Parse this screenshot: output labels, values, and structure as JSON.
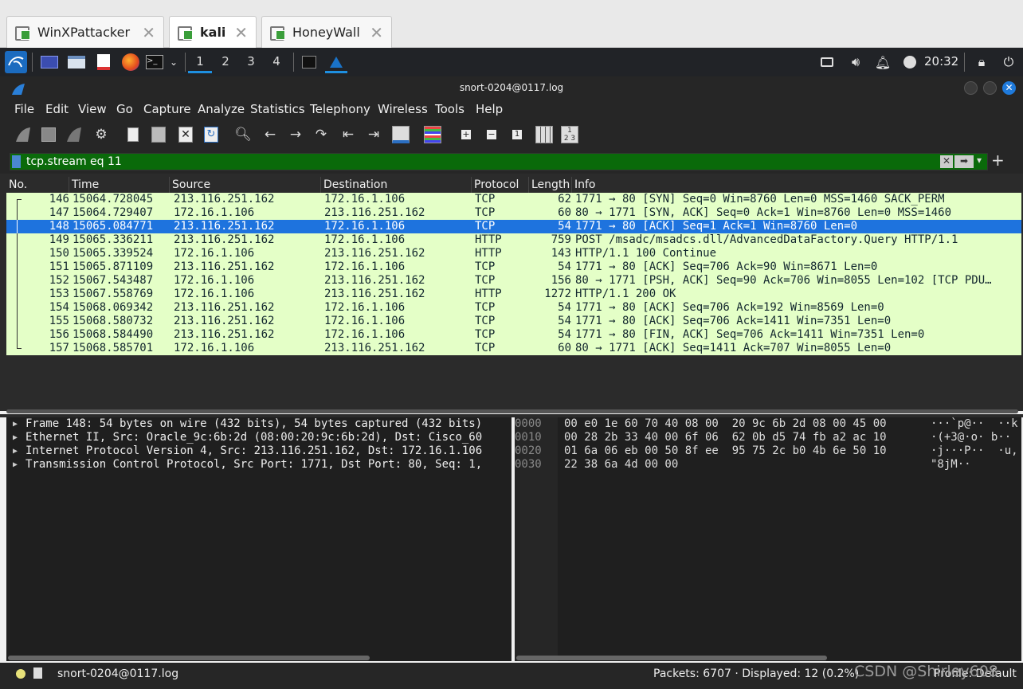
{
  "vm_tabs": [
    {
      "label": "WinXPattacker",
      "active": false
    },
    {
      "label": "kali",
      "active": true
    },
    {
      "label": "HoneyWall",
      "active": false
    }
  ],
  "panel": {
    "workspaces": [
      "1",
      "2",
      "3",
      "4"
    ],
    "active_workspace": "1",
    "clock": "20:32"
  },
  "window": {
    "title": "snort-0204@0117.log"
  },
  "menu": [
    "File",
    "Edit",
    "View",
    "Go",
    "Capture",
    "Analyze",
    "Statistics",
    "Telephony",
    "Wireless",
    "Tools",
    "Help"
  ],
  "filter": {
    "value": "tcp.stream eq 11",
    "clear_icon": "✕",
    "apply_icon": "➡",
    "dropdown_icon": "▾",
    "add_icon": "+"
  },
  "columns": [
    "No.",
    "Time",
    "Source",
    "Destination",
    "Protocol",
    "Length",
    "Info"
  ],
  "packets": [
    {
      "no": "146",
      "time": "15064.728045",
      "src": "213.116.251.162",
      "dst": "172.16.1.106",
      "proto": "TCP",
      "len": "62",
      "info": "1771 → 80 [SYN] Seq=0 Win=8760 Len=0 MSS=1460 SACK_PERM",
      "selected": false
    },
    {
      "no": "147",
      "time": "15064.729407",
      "src": "172.16.1.106",
      "dst": "213.116.251.162",
      "proto": "TCP",
      "len": "60",
      "info": "80 → 1771 [SYN, ACK] Seq=0 Ack=1 Win=8760 Len=0 MSS=1460",
      "selected": false
    },
    {
      "no": "148",
      "time": "15065.084771",
      "src": "213.116.251.162",
      "dst": "172.16.1.106",
      "proto": "TCP",
      "len": "54",
      "info": "1771 → 80 [ACK] Seq=1 Ack=1 Win=8760 Len=0",
      "selected": true
    },
    {
      "no": "149",
      "time": "15065.336211",
      "src": "213.116.251.162",
      "dst": "172.16.1.106",
      "proto": "HTTP",
      "len": "759",
      "info": "POST /msadc/msadcs.dll/AdvancedDataFactory.Query HTTP/1.1",
      "selected": false
    },
    {
      "no": "150",
      "time": "15065.339524",
      "src": "172.16.1.106",
      "dst": "213.116.251.162",
      "proto": "HTTP",
      "len": "143",
      "info": "HTTP/1.1 100 Continue",
      "selected": false
    },
    {
      "no": "151",
      "time": "15065.871109",
      "src": "213.116.251.162",
      "dst": "172.16.1.106",
      "proto": "TCP",
      "len": "54",
      "info": "1771 → 80 [ACK] Seq=706 Ack=90 Win=8671 Len=0",
      "selected": false
    },
    {
      "no": "152",
      "time": "15067.543487",
      "src": "172.16.1.106",
      "dst": "213.116.251.162",
      "proto": "TCP",
      "len": "156",
      "info": "80 → 1771 [PSH, ACK] Seq=90 Ack=706 Win=8055 Len=102 [TCP PDU…",
      "selected": false
    },
    {
      "no": "153",
      "time": "15067.558769",
      "src": "172.16.1.106",
      "dst": "213.116.251.162",
      "proto": "HTTP",
      "len": "1272",
      "info": "HTTP/1.1 200 OK",
      "selected": false
    },
    {
      "no": "154",
      "time": "15068.069342",
      "src": "213.116.251.162",
      "dst": "172.16.1.106",
      "proto": "TCP",
      "len": "54",
      "info": "1771 → 80 [ACK] Seq=706 Ack=192 Win=8569 Len=0",
      "selected": false
    },
    {
      "no": "155",
      "time": "15068.580732",
      "src": "213.116.251.162",
      "dst": "172.16.1.106",
      "proto": "TCP",
      "len": "54",
      "info": "1771 → 80 [ACK] Seq=706 Ack=1411 Win=7351 Len=0",
      "selected": false
    },
    {
      "no": "156",
      "time": "15068.584490",
      "src": "213.116.251.162",
      "dst": "172.16.1.106",
      "proto": "TCP",
      "len": "54",
      "info": "1771 → 80 [FIN, ACK] Seq=706 Ack=1411 Win=7351 Len=0",
      "selected": false
    },
    {
      "no": "157",
      "time": "15068.585701",
      "src": "172.16.1.106",
      "dst": "213.116.251.162",
      "proto": "TCP",
      "len": "60",
      "info": "80 → 1771 [ACK] Seq=1411 Ack=707 Win=8055 Len=0",
      "selected": false
    }
  ],
  "details": [
    "Frame 148: 54 bytes on wire (432 bits), 54 bytes captured (432 bits)",
    "Ethernet II, Src: Oracle_9c:6b:2d (08:00:20:9c:6b:2d), Dst: Cisco_60",
    "Internet Protocol Version 4, Src: 213.116.251.162, Dst: 172.16.1.106",
    "Transmission Control Protocol, Src Port: 1771, Dst Port: 80, Seq: 1,"
  ],
  "hex": {
    "offsets": [
      "0000",
      "0010",
      "0020",
      "0030"
    ],
    "bytes": [
      "00 e0 1e 60 70 40 08 00  20 9c 6b 2d 08 00 45 00",
      "00 28 2b 33 40 00 6f 06  62 0b d5 74 fb a2 ac 10",
      "01 6a 06 eb 00 50 8f ee  95 75 2c b0 4b 6e 50 10",
      "22 38 6a 4d 00 00"
    ],
    "ascii": [
      "···`p@··  ··k",
      "·(+3@·o· b··",
      "·j···P··  ·u,",
      "\"8jM··"
    ]
  },
  "status": {
    "file": "snort-0204@0117.log",
    "packets": "Packets: 6707 · Displayed: 12 (0.2%)",
    "profile": "Profile: Default"
  },
  "watermark": "CSDN @Shirley608",
  "colors": {
    "tcp_row_bg": "#e4ffc7",
    "selected_row_bg": "#1e73de",
    "filter_valid_bg": "#0a6a0a"
  }
}
